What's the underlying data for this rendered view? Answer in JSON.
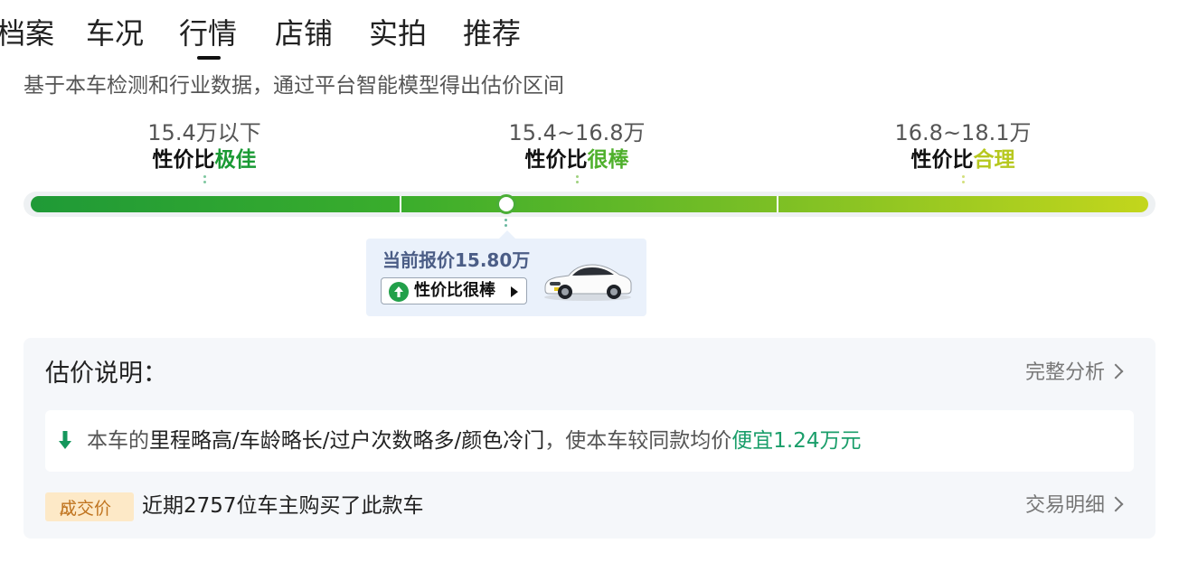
{
  "tabs": [
    "档案",
    "车况",
    "行情",
    "店铺",
    "实拍",
    "推荐"
  ],
  "active_tab": "行情",
  "subtitle": "基于本车检测和行业数据，通过平台智能模型得出估价区间",
  "ranges": [
    {
      "price": "15.4万以下",
      "grade_prefix": "性价比",
      "grade_word": "极佳",
      "grade_color": "#1a9a34"
    },
    {
      "price": "15.4~16.8万",
      "grade_prefix": "性价比",
      "grade_word": "很棒",
      "grade_color": "#4fb02c"
    },
    {
      "price": "16.8~18.1万",
      "grade_prefix": "性价比",
      "grade_word": "合理",
      "grade_color": "#b7c81f"
    }
  ],
  "price_card": {
    "title": "当前报价15.80万",
    "badge": "性价比很棒"
  },
  "explanation": {
    "title": "估价说明：",
    "full_analysis": "完整分析",
    "reason_prefix": "本车的",
    "reason_factors": "里程略高/车龄略长/过户次数略多/颜色冷门",
    "reason_mid": "，使本车较同款均价",
    "reason_result": "便宜1.24万元",
    "deal_badge": "成交价",
    "deal_text": "近期2757位车主购买了此款车",
    "trade_detail": "交易明细"
  },
  "colors": {
    "accent_green": "#1a9e6a",
    "bar_start": "#1f9a37",
    "bar_end": "#c3d61c",
    "badge_bg": "#fde9c7",
    "badge_text": "#c0741f"
  }
}
